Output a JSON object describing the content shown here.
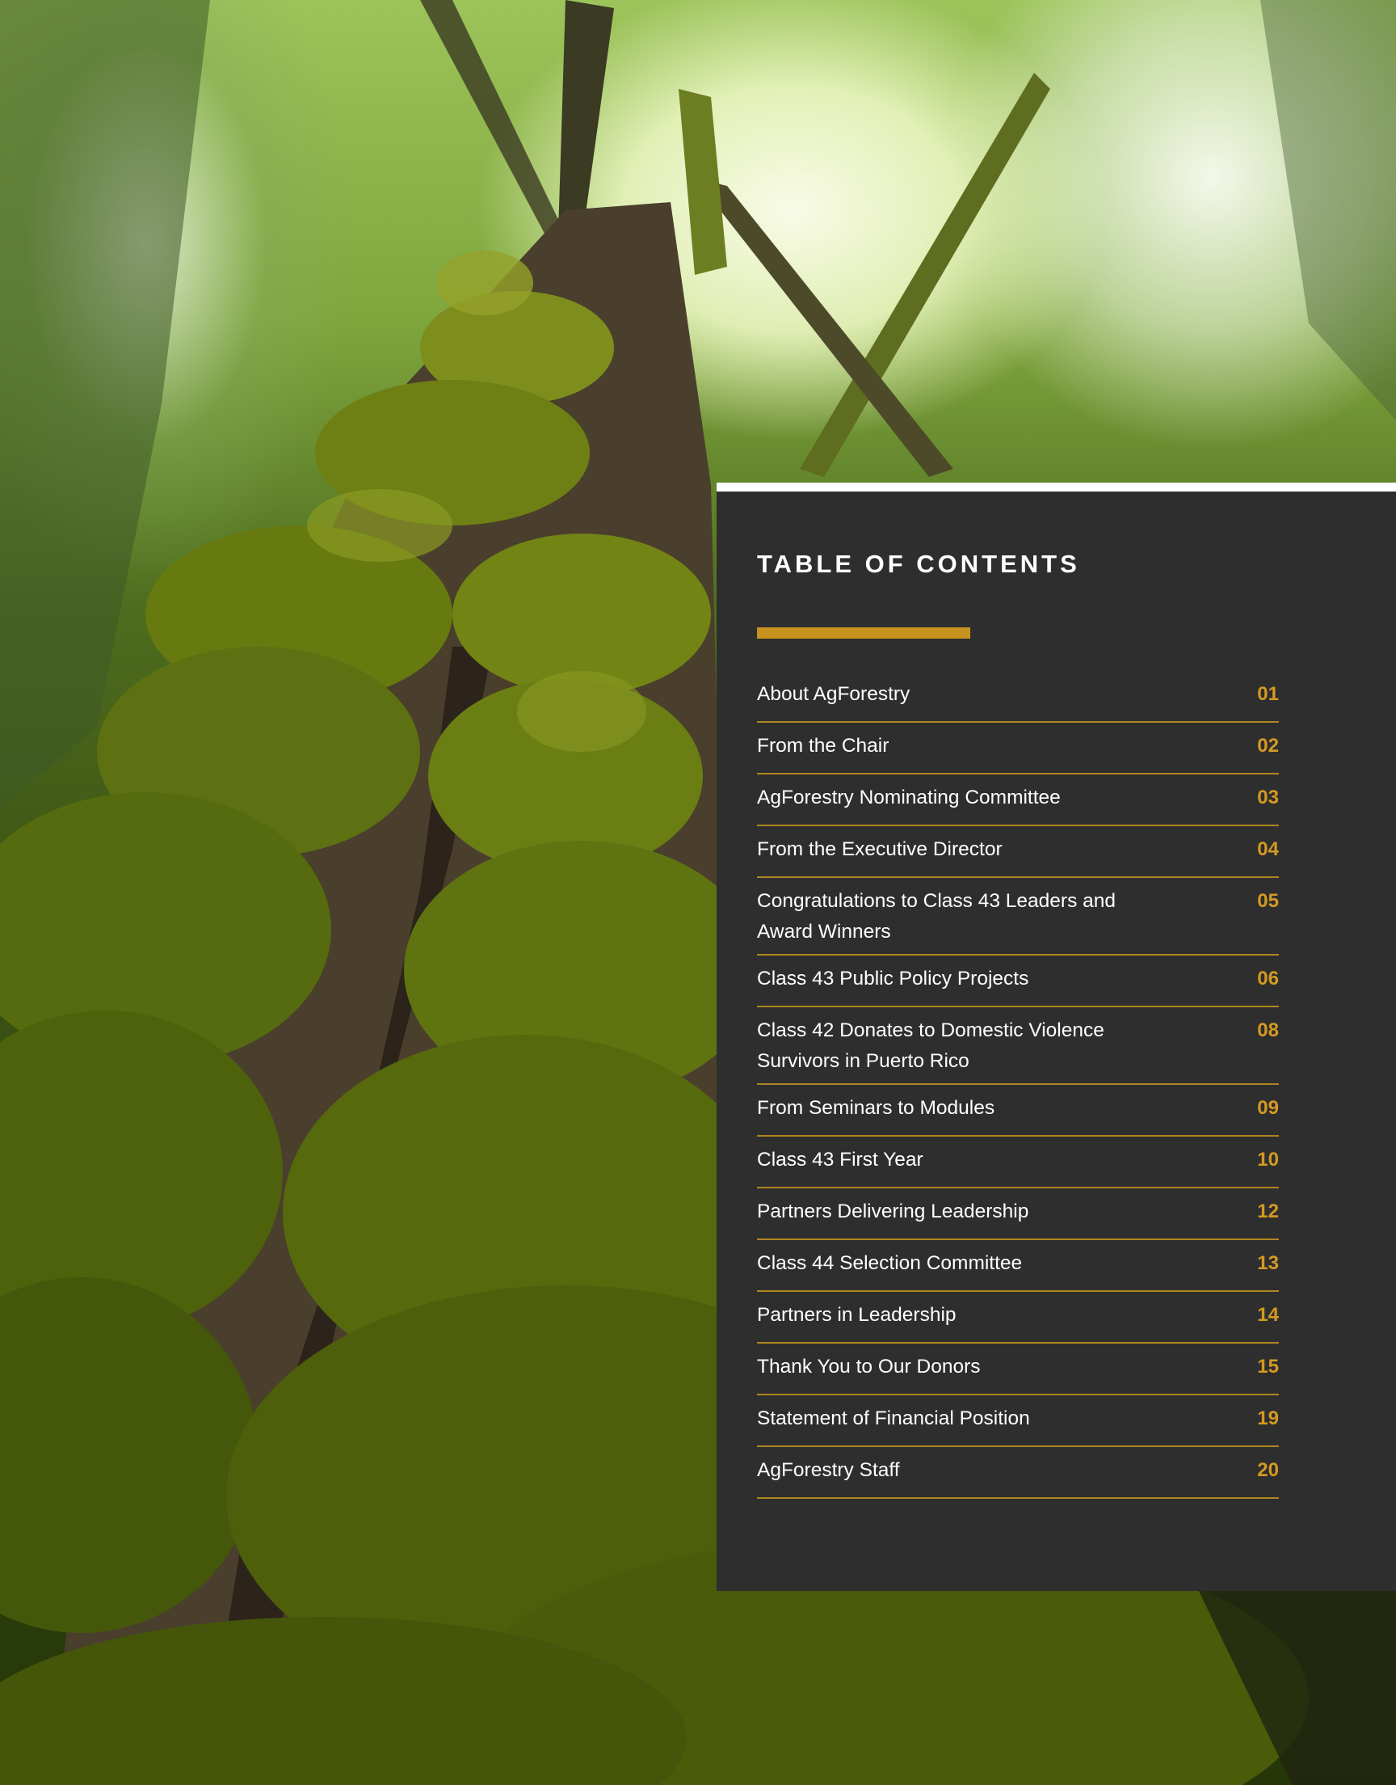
{
  "toc": {
    "title": "TABLE OF CONTENTS",
    "accent_color": "#c8921e",
    "panel_color": "#2f2e2e",
    "items": [
      {
        "label": "About AgForestry",
        "page": "01"
      },
      {
        "label": "From the Chair",
        "page": "02"
      },
      {
        "label": "AgForestry Nominating Committee",
        "page": "03"
      },
      {
        "label": "From the Executive Director",
        "page": "04"
      },
      {
        "label": "Congratulations to Class 43 Leaders and Award Winners",
        "page": "05"
      },
      {
        "label": "Class 43 Public Policy Projects",
        "page": "06"
      },
      {
        "label": "Class 42 Donates to Domestic Violence Survivors in Puerto Rico",
        "page": "08"
      },
      {
        "label": "From Seminars to Modules",
        "page": "09"
      },
      {
        "label": "Class 43 First Year",
        "page": "10"
      },
      {
        "label": "Partners Delivering Leadership",
        "page": "12"
      },
      {
        "label": "Class 44 Selection Committee",
        "page": "13"
      },
      {
        "label": "Partners in Leadership",
        "page": "14"
      },
      {
        "label": "Thank You to Our Donors",
        "page": "15"
      },
      {
        "label": "Statement of Financial Position",
        "page": "19"
      },
      {
        "label": "AgForestry Staff",
        "page": "20"
      }
    ]
  }
}
